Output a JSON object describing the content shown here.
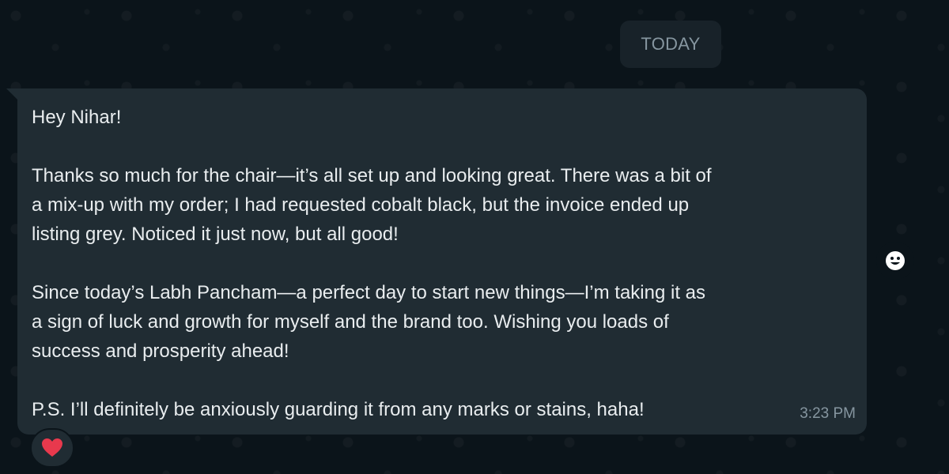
{
  "date_chip": "TODAY",
  "message": {
    "paragraphs": [
      "Hey Nihar!",
      "Thanks so much for the chair—it’s all set up and looking great. There was a bit of\na mix-up with my order; I had requested cobalt black, but the invoice ended up\nlisting grey. Noticed it just now, but all good!",
      "Since today’s Labh Pancham—a perfect day to start new things—I’m taking it as\na sign of luck and growth for myself and the brand too. Wishing you loads of\nsuccess and prosperity ahead!",
      "P.S. I’ll definitely be anxiously guarding it from any marks or stains, haha!"
    ],
    "time": "3:23 PM"
  },
  "reaction": {
    "icon": "heart-icon",
    "color": "#e8394d"
  },
  "react_button": {
    "icon": "smiley-icon"
  },
  "colors": {
    "background": "#0b141a",
    "bubble": "#202c33",
    "text": "#e9edef",
    "muted": "#8696a0"
  }
}
